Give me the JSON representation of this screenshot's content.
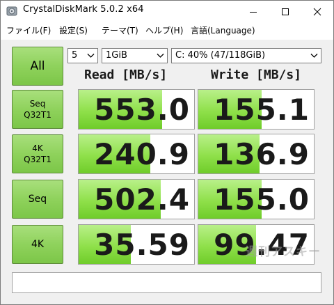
{
  "window": {
    "title": "CrystalDiskMark 5.0.2 x64",
    "minimize_icon": "minimize-icon",
    "maximize_icon": "maximize-icon",
    "close_icon": "close-icon"
  },
  "menu": [
    {
      "label": "ファイル(F)"
    },
    {
      "label": "設定(S)"
    },
    {
      "label": "テーマ(T)"
    },
    {
      "label": "ヘルプ(H)"
    },
    {
      "label": "言語(Language)"
    }
  ],
  "controls": {
    "all_label": "All",
    "test_count": "5",
    "test_size": "1GiB",
    "drive": "C: 40% (47/118GiB)"
  },
  "columns": {
    "read": "Read [MB/s]",
    "write": "Write [MB/s]"
  },
  "rows": [
    {
      "line1": "Seq",
      "line2": "Q32T1",
      "read": "553.0",
      "write": "155.1",
      "read_fill": 0.72,
      "write_fill": 0.55
    },
    {
      "line1": "4K",
      "line2": "Q32T1",
      "read": "240.9",
      "write": "136.9",
      "read_fill": 0.62,
      "write_fill": 0.53
    },
    {
      "line1": "Seq",
      "line2": "",
      "read": "502.4",
      "write": "155.0",
      "read_fill": 0.71,
      "write_fill": 0.55
    },
    {
      "line1": "4K",
      "line2": "",
      "read": "35.59",
      "write": "99.47",
      "read_fill": 0.45,
      "write_fill": 0.5
    }
  ],
  "comment": "",
  "watermark": "週刊アスキー",
  "colors": {
    "button_green": "#8fd25c",
    "bar_green": "#8fe04a"
  }
}
